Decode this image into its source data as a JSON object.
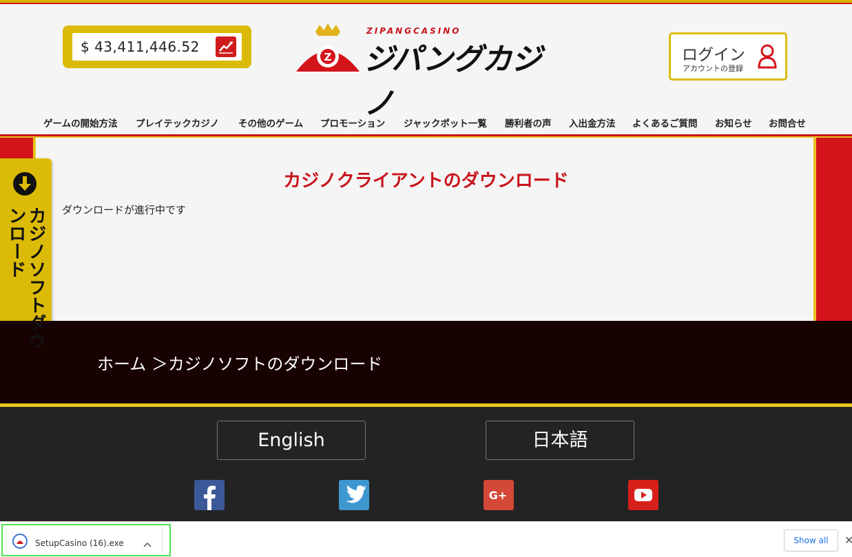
{
  "header": {
    "jackpot_value": "$ 43,411,446.52",
    "logo_small_text": "ZIPANGCASINO",
    "logo_main_text": "ジパングカジノ",
    "login_title": "ログイン",
    "login_subtitle": "アカウントの登録"
  },
  "nav": {
    "items": [
      {
        "label": "ゲームの開始方法"
      },
      {
        "label": "プレイテックカジノ"
      },
      {
        "label": "その他のゲーム"
      },
      {
        "label": "プロモーション"
      },
      {
        "label": "ジャックポット一覧"
      },
      {
        "label": "勝利者の声"
      },
      {
        "label": "入出金方法"
      },
      {
        "label": "よくあるご質問"
      },
      {
        "label": "お知らせ"
      },
      {
        "label": "お問合せ"
      }
    ]
  },
  "side_tab": {
    "label": "カジノソフトダウンロード"
  },
  "main": {
    "title": "カジノクライアントのダウンロード",
    "status_text": "ダウンロードが進行中です"
  },
  "breadcrumb": {
    "text": "ホーム ＞カジノソフトのダウンロード"
  },
  "footer": {
    "languages": [
      {
        "label": "English"
      },
      {
        "label": "日本語"
      }
    ],
    "social": [
      {
        "icon": "facebook-icon",
        "label": "f",
        "color": "#3b5998"
      },
      {
        "icon": "twitter-icon",
        "label": "",
        "color": "#3f97d0"
      },
      {
        "icon": "google-plus-icon",
        "label": "G+",
        "color": "#d34836"
      },
      {
        "icon": "youtube-icon",
        "label": "",
        "color": "#d8201b"
      }
    ]
  },
  "download_bar": {
    "file_name": "SetupCasino (16).exe",
    "show_all_label": "Show all",
    "close_label": "✕"
  },
  "colors": {
    "brand_red": "#c8141b",
    "brand_gold": "#dcbb08",
    "dark_band": "#180101",
    "footer_bg": "#232323"
  }
}
